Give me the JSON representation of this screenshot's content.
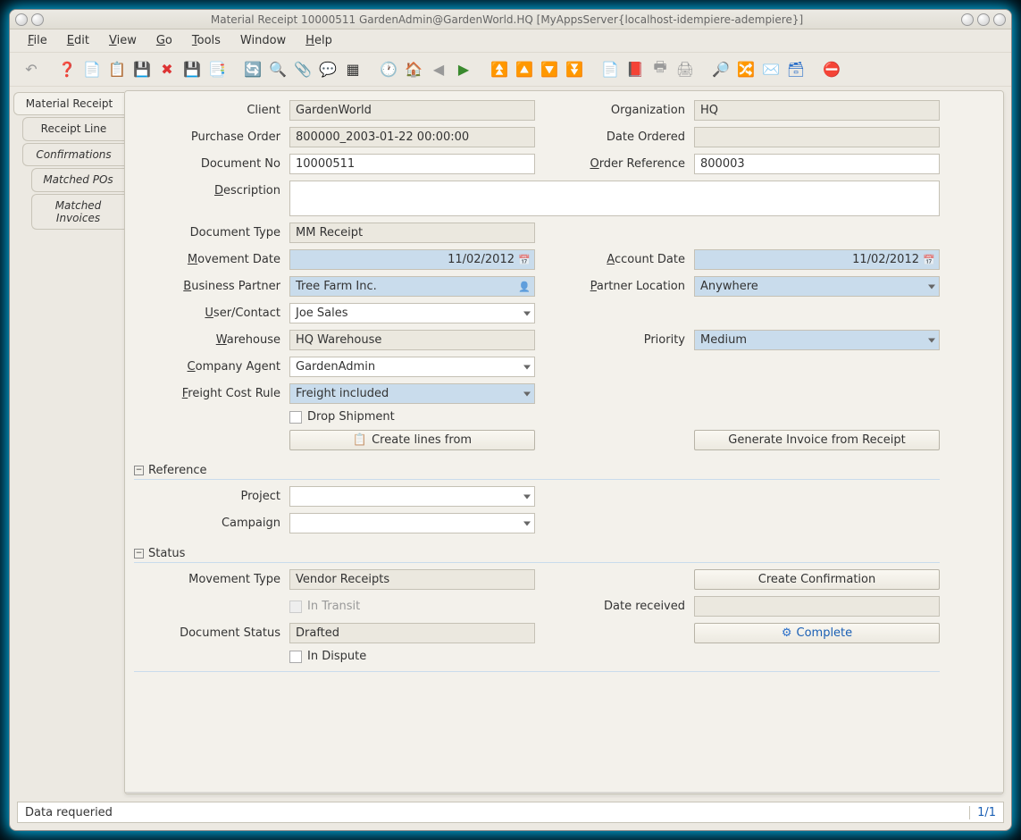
{
  "window": {
    "title": "Material Receipt  10000511  GardenAdmin@GardenWorld.HQ [MyAppsServer{localhost-idempiere-adempiere}]"
  },
  "menubar": [
    "File",
    "Edit",
    "View",
    "Go",
    "Tools",
    "Window",
    "Help"
  ],
  "tabs": {
    "material_receipt": "Material Receipt",
    "receipt_line": "Receipt Line",
    "confirmations": "Confirmations",
    "matched_pos": "Matched POs",
    "matched_invoices": "Matched Invoices"
  },
  "labels": {
    "client": "Client",
    "organization": "Organization",
    "purchase_order": "Purchase Order",
    "date_ordered": "Date Ordered",
    "document_no": "Document No",
    "order_reference": "Order Reference",
    "description": "Description",
    "document_type": "Document Type",
    "movement_date": "Movement Date",
    "account_date": "Account Date",
    "business_partner": "Business Partner",
    "partner_location": "Partner Location",
    "user_contact": "User/Contact",
    "warehouse": "Warehouse",
    "priority": "Priority",
    "company_agent": "Company Agent",
    "freight_cost_rule": "Freight Cost Rule",
    "drop_shipment": "Drop Shipment",
    "create_lines_from": "Create lines from",
    "generate_invoice": "Generate Invoice from Receipt",
    "reference": "Reference",
    "project": "Project",
    "campaign": "Campaign",
    "status": "Status",
    "movement_type": "Movement Type",
    "create_confirmation": "Create Confirmation",
    "in_transit": "In Transit",
    "date_received": "Date received",
    "document_status": "Document Status",
    "complete": "Complete",
    "in_dispute": "In Dispute"
  },
  "values": {
    "client": "GardenWorld",
    "organization": "HQ",
    "purchase_order": "800000_2003-01-22 00:00:00",
    "date_ordered": "",
    "document_no": "10000511",
    "order_reference": "800003",
    "description": "",
    "document_type": "MM Receipt",
    "movement_date": "11/02/2012",
    "account_date": "11/02/2012",
    "business_partner": "Tree Farm Inc.",
    "partner_location": "Anywhere",
    "user_contact": "Joe Sales",
    "warehouse": "HQ Warehouse",
    "priority": "Medium",
    "company_agent": "GardenAdmin",
    "freight_cost_rule": "Freight included",
    "project": "",
    "campaign": "",
    "movement_type": "Vendor Receipts",
    "date_received": "",
    "document_status": "Drafted"
  },
  "statusbar": {
    "message": "Data requeried",
    "record": "1/1"
  }
}
